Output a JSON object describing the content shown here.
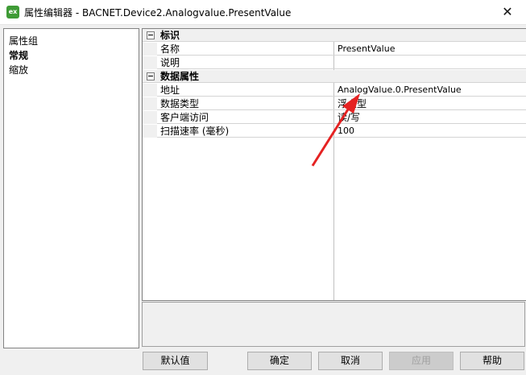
{
  "window": {
    "title": "属性编辑器 - BACNET.Device2.Analogvalue.PresentValue",
    "app_icon_text": "ex",
    "close_glyph": "✕"
  },
  "left_panel": {
    "items": [
      "属性组",
      "常规",
      "缩放"
    ],
    "selected_index": 1
  },
  "grid": {
    "categories": [
      {
        "label": "标识",
        "rows": [
          {
            "name": "名称",
            "value": "PresentValue"
          },
          {
            "name": "说明",
            "value": ""
          }
        ]
      },
      {
        "label": "数据属性",
        "rows": [
          {
            "name": "地址",
            "value": "AnalogValue.0.PresentValue"
          },
          {
            "name": "数据类型",
            "value": "浮点型"
          },
          {
            "name": "客户端访问",
            "value": "读/写"
          },
          {
            "name": "扫描速率 (毫秒)",
            "value": "100"
          }
        ]
      }
    ]
  },
  "buttons": {
    "default": "默认值",
    "ok": "确定",
    "cancel": "取消",
    "apply": "应用",
    "help": "帮助"
  },
  "annotation_color": "#e52222"
}
